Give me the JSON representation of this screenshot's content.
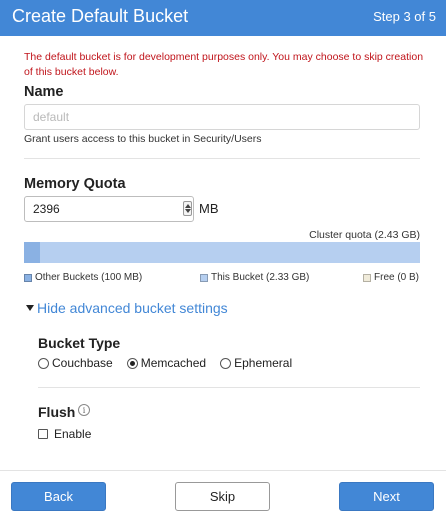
{
  "header": {
    "title": "Create Default Bucket",
    "step": "Step 3 of 5",
    "color": "#4287d6"
  },
  "warning": "The default bucket is for development purposes only. You may choose to skip creation of this bucket below.",
  "name": {
    "label": "Name",
    "placeholder": "default",
    "help": "Grant users access to this bucket in Security/Users"
  },
  "memory": {
    "label": "Memory Quota",
    "value": "2396",
    "unit": "MB",
    "cluster_quota": "Cluster quota (2.43 GB)",
    "bar": {
      "other_fraction": 0.04,
      "this_fraction": 0.96
    },
    "legend": [
      {
        "label": "Other Buckets (100 MB)",
        "color": "#8ab1e3"
      },
      {
        "label": "This Bucket (2.33 GB)",
        "color": "#b6cff0"
      },
      {
        "label": "Free (0 B)",
        "color": "#f0ebda"
      }
    ]
  },
  "advanced": {
    "label": "Hide advanced bucket settings",
    "expanded": true
  },
  "bucket_type": {
    "label": "Bucket Type",
    "options": [
      "Couchbase",
      "Memcached",
      "Ephemeral"
    ],
    "selected": "Memcached"
  },
  "flush": {
    "label": "Flush",
    "info_icon": "info-icon",
    "enable_label": "Enable",
    "checked": false
  },
  "buttons": {
    "back": "Back",
    "skip": "Skip",
    "next": "Next"
  }
}
